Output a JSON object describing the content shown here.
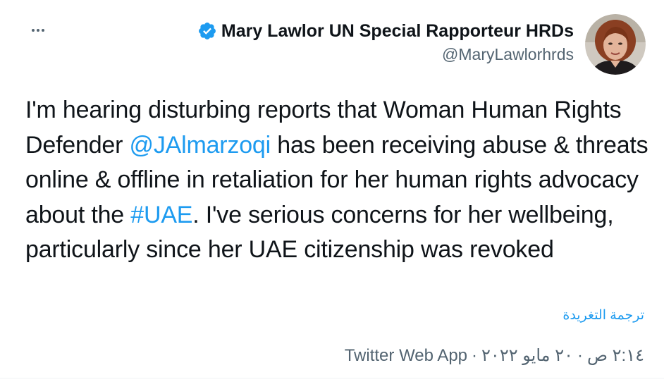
{
  "author": {
    "display_name": "Mary Lawlor UN Special Rapporteur HRDs",
    "handle": "@MaryLawlorhrds",
    "verified": true
  },
  "tweet": {
    "segments": [
      {
        "text": "I'm hearing disturbing reports that Woman Human Rights Defender ",
        "link": false
      },
      {
        "text": "@JAlmarzoqi",
        "link": true
      },
      {
        "text": " has been receiving abuse & threats online & offline in retaliation for her human rights advocacy about the ",
        "link": false
      },
      {
        "text": "#UAE",
        "link": true
      },
      {
        "text": ". I've serious concerns for her wellbeing, particularly since her UAE citizenship was revoked",
        "link": false
      }
    ],
    "translate_label": "ترجمة التغريدة",
    "time": "٢:١٤ ص",
    "date": "٢٠ مايو ٢٠٢٢",
    "source": "Twitter Web App",
    "separator": "·"
  },
  "icons": {
    "more": "more-horizontal-icon",
    "verified": "verified-badge-icon"
  },
  "colors": {
    "link": "#1d9bf0",
    "secondary_text": "#536471",
    "primary_text": "#0f1419",
    "background": "#ffffff"
  }
}
